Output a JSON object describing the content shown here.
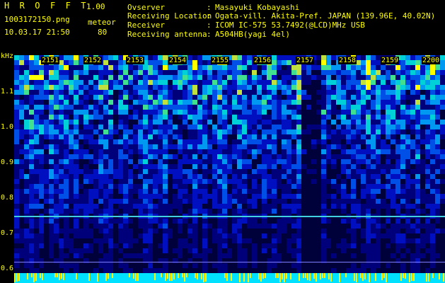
{
  "header": {
    "app_title": "H R O F F T",
    "version": "1.00",
    "filename": "1003172150.png",
    "mode": "meteor",
    "datetime": "10.03.17 21:50",
    "count": "80",
    "meta": [
      {
        "label": "Ovserver",
        "value": "Masayuki Kobayashi"
      },
      {
        "label": "Receiving Location",
        "value": "Ogata-vill. Akita-Pref. JAPAN (139.96E, 40.02N)"
      },
      {
        "label": "Receiver",
        "value": "ICOM IC-575 53.7492(@LCD)MHz USB"
      },
      {
        "label": "Receiving antenna",
        "value": "A504HB(yagi 4el)"
      }
    ],
    "separator": ":"
  },
  "spectrogram": {
    "freq_unit": "kHz",
    "freq_ticks": [
      "1.1",
      "1.0",
      "0.9",
      "0.8",
      "0.7",
      "0.6"
    ],
    "time_ticks": [
      "2151",
      "2152",
      "2153",
      "2154",
      "2155",
      "2156",
      "2157",
      "2158",
      "2159",
      "2200"
    ],
    "colors": {
      "background": "#000000",
      "label": "#ffff00",
      "low": "#0000a0",
      "mid": "#00c0ff",
      "high": "#ffff00"
    }
  }
}
